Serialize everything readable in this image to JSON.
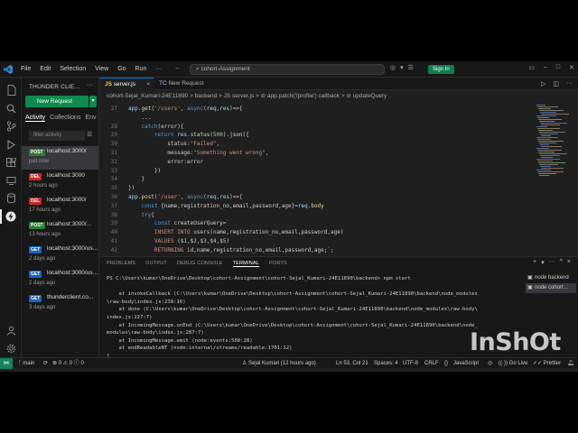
{
  "titlebar": {
    "menu": [
      "File",
      "Edit",
      "Selection",
      "View",
      "Go",
      "Run",
      "···"
    ],
    "search": "cohort-Assignment",
    "signin": "Sign In"
  },
  "sidebar": {
    "title": "THUNDER CLIE...",
    "new_request": "New Request",
    "tabs": [
      "Activity",
      "Collections",
      "Env"
    ],
    "filter_placeholder": "filter activity",
    "requests": [
      {
        "method": "POST",
        "url": "localhost:3000/",
        "time": "just now",
        "color": "#2e7d32"
      },
      {
        "method": "DEL",
        "url": "localhost:3000",
        "time": "2 hours ago",
        "color": "#c62828"
      },
      {
        "method": "DEL",
        "url": "localhost:3000/",
        "time": "17 hours ago",
        "color": "#c62828"
      },
      {
        "method": "POST",
        "url": "localhost:3000/...",
        "time": "13 hours ago",
        "color": "#2e7d32"
      },
      {
        "method": "GET",
        "url": "localhost:3000/us...",
        "time": "2 days ago",
        "color": "#1565c0"
      },
      {
        "method": "GET",
        "url": "localhost:3000/us...",
        "time": "2 days ago",
        "color": "#1565c0"
      },
      {
        "method": "GET",
        "url": "thunderclient.co...",
        "time": "3 days ago",
        "color": "#1565c0"
      }
    ]
  },
  "editor": {
    "tabs": [
      "server.js",
      "New Request"
    ],
    "breadcrumb": "cohort-Sejal_Kumari-24E11890 > backend > JS server.js > ⊘ app.patch('/profile') callback > ⊘ updateQuery",
    "lines": [
      {
        "n": "27",
        "t": "app.get('/users', async(req,res)=>{"
      },
      {
        "n": "",
        "t": "    ..."
      },
      {
        "n": "28",
        "t": "    catch(error){"
      },
      {
        "n": "29",
        "t": "        return res.status(500).json({"
      },
      {
        "n": "30",
        "t": "            status:\"Failed\","
      },
      {
        "n": "31",
        "t": "            message:\"Something went wrong\","
      },
      {
        "n": "32",
        "t": "            error:error"
      },
      {
        "n": "33",
        "t": "        })"
      },
      {
        "n": "34",
        "t": "    }"
      },
      {
        "n": "35",
        "t": "})"
      },
      {
        "n": "36",
        "t": "app.post('/user', async(req,res)=>{"
      },
      {
        "n": "37",
        "t": "    const {name,registration_no,email,password,age}=req.body"
      },
      {
        "n": "38",
        "t": "    try{"
      },
      {
        "n": "39",
        "t": "        const createUserQuery=`"
      },
      {
        "n": "40",
        "t": "        INSERT INTO users(name,registration_no,email,password,age)"
      },
      {
        "n": "41",
        "t": "        VALUES ($1,$2,$3,$4,$5)"
      },
      {
        "n": "42",
        "t": "        RETURNING id,name,registration_no,email,password,age;`;"
      }
    ]
  },
  "panel": {
    "tabs": [
      "PROBLEMS",
      "OUTPUT",
      "DEBUG CONSOLE",
      "TERMINAL",
      "PORTS"
    ],
    "active_tab": "TERMINAL",
    "terminal_lines": [
      "PS C:\\Users\\kumar\\OneDrive\\Desktop\\cohort-Assignment\\cohort-Sejal_Kumari-24E11890\\backend> npm start",
      "",
      "    at invokeCallback (C:\\Users\\kumar\\OneDrive\\Desktop\\cohort-Assignment\\cohort-Sejal_Kumari-24E11890\\backend\\node_modules",
      "\\raw-body\\index.js:238:16)",
      "    at done (C:\\Users\\kumar\\OneDrive\\Desktop\\cohort-Assignment\\cohort-Sejal_Kumari-24E11890\\backend\\node_modules\\raw-body\\",
      "index.js:227:7)",
      "    at IncomingMessage.onEnd (C:\\Users\\kumar\\OneDrive\\Desktop\\cohort-Assignment\\cohort-Sejal_Kumari-24E11890\\backend\\node_",
      "modules\\raw-body\\index.js:287:7)",
      "    at IncomingMessage.emit (node:events:508:28)",
      "    at endReadableNT (node:internal/streams/readable:1701:12)",
      "]"
    ],
    "terminals": [
      "node backend",
      "node cohort..."
    ]
  },
  "statusbar": {
    "branch": "main",
    "errors": "0",
    "warnings": "0",
    "problems": "0",
    "author": "Sejal Kumari (12 hours ago)",
    "position": "Ln 53, Col 21",
    "spaces": "Spaces: 4",
    "encoding": "UTF-8",
    "eol": "CRLF",
    "language": "JavaScript",
    "golive": "Go Live",
    "prettier": "Prettier"
  },
  "watermark": "InShOt"
}
